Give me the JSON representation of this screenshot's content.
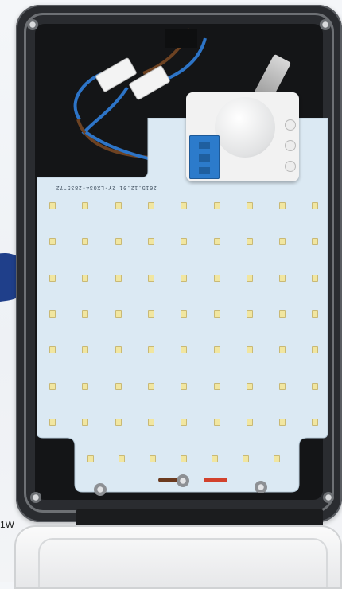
{
  "photo": {
    "subject": "Opened LED floodlight housing with motion sensor and LED board",
    "board_marking": "2015.12.01   2Y-LX034-2835*72",
    "side_label": "1W"
  },
  "colors": {
    "housing": "#2a2c30",
    "board": "#dbe9f3",
    "led": "#f1e6a0",
    "terminal": "#2c7bcb",
    "accent_blue": "#1f3f8a"
  },
  "led_grid": {
    "rows": 7,
    "cols": 9,
    "bottom_row_count": 7
  }
}
